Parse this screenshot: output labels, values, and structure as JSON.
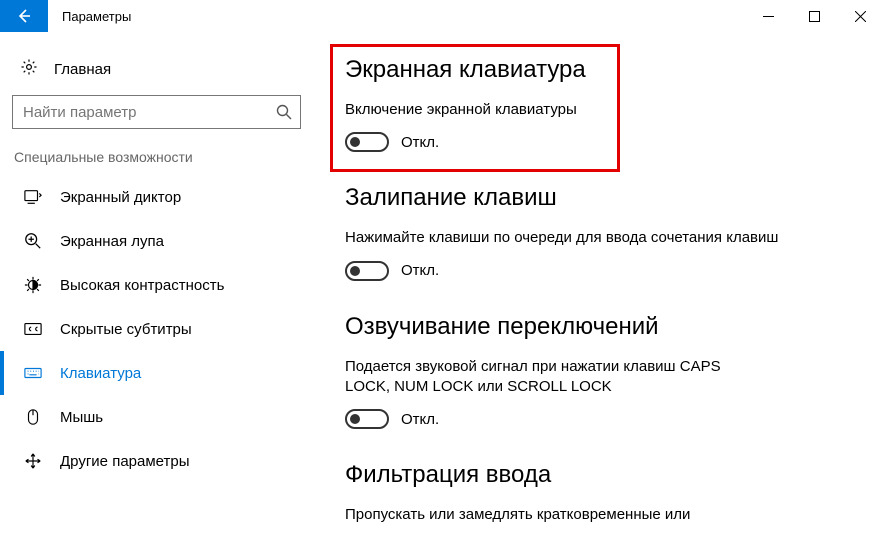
{
  "window": {
    "title": "Параметры"
  },
  "sidebar": {
    "home": "Главная",
    "search_placeholder": "Найти параметр",
    "category": "Специальные возможности",
    "items": [
      {
        "label": "Экранный диктор"
      },
      {
        "label": "Экранная лупа"
      },
      {
        "label": "Высокая контрастность"
      },
      {
        "label": "Скрытые субтитры"
      },
      {
        "label": "Клавиатура"
      },
      {
        "label": "Мышь"
      },
      {
        "label": "Другие параметры"
      }
    ]
  },
  "content": {
    "sections": [
      {
        "heading": "Экранная клавиатура",
        "desc": "Включение экранной клавиатуры",
        "toggle_state": "Откл."
      },
      {
        "heading": "Залипание клавиш",
        "desc": "Нажимайте клавиши по очереди для ввода сочетания клавиш",
        "toggle_state": "Откл."
      },
      {
        "heading": "Озвучивание переключений",
        "desc": "Подается звуковой сигнал при нажатии клавиш CAPS LOCK, NUM LOCK или SCROLL LOCK",
        "toggle_state": "Откл."
      },
      {
        "heading": "Фильтрация ввода",
        "desc": "Пропускать или замедлять кратковременные или"
      }
    ]
  }
}
